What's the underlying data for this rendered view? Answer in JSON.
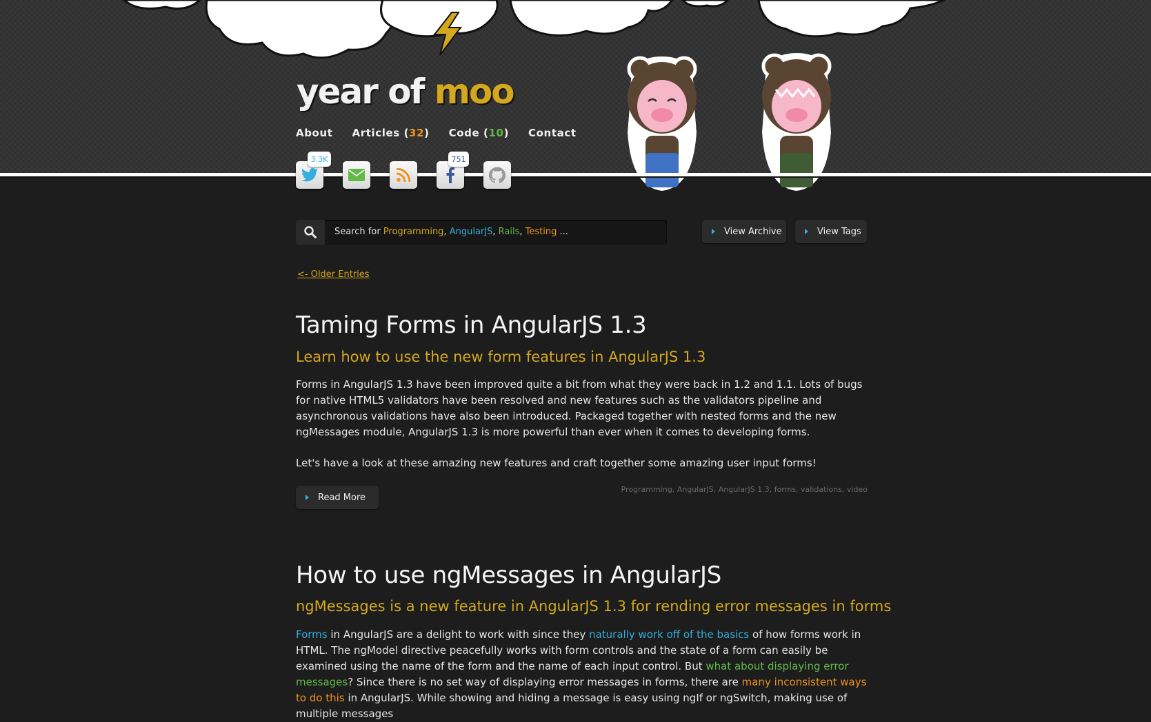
{
  "logo": {
    "part1": "year of",
    "part2": "moo"
  },
  "nav": {
    "about": "About",
    "articles_label": "Articles (",
    "articles_count": "32",
    "code_label": "Code (",
    "code_count": "10",
    "close_paren": ")",
    "contact": "Contact"
  },
  "social": {
    "twitter_count": "3.3K",
    "facebook_count": "751",
    "icons": [
      "twitter-icon",
      "email-icon",
      "rss-icon",
      "facebook-icon",
      "github-icon"
    ]
  },
  "search": {
    "prefix": "Search for ",
    "term1": "Programming",
    "term2": "AngularJS",
    "term3": "Rails",
    "term4": "Testing",
    "comma": ",",
    "ellipsis": " ..."
  },
  "buttons": {
    "view_archive": "View Archive",
    "view_tags": "View Tags",
    "read_more": "Read More"
  },
  "older_entries": "<- Older Entries",
  "posts": [
    {
      "title": "Taming Forms in AngularJS 1.3",
      "subtitle": "Learn how to use the new form features in AngularJS 1.3",
      "para1": "Forms in AngularJS 1.3 have been improved quite a bit from what they were back in 1.2 and 1.1. Lots of bugs for native HTML5 validators have been resolved and new features such as the validators pipeline and asynchronous validations have also been introduced. Packaged together with nested forms and the new ngMessages module, AngularJS 1.3 is more powerful than ever when it comes to developing forms.",
      "para2": "Let's have a look at these amazing new features and craft together some amazing user input forms!",
      "tags": "Programming, AngularJS, AngularJS 1.3, forms, validations, video"
    },
    {
      "title": "How to use ngMessages in AngularJS",
      "subtitle": "ngMessages is a new feature in AngularJS 1.3 for rending error messages in forms",
      "p_a": "Forms",
      "p_b": " in AngularJS are a delight to work with since they ",
      "p_c": "naturally work off of the basics",
      "p_d": " of how forms work in HTML. The ngModel directive peacefully works with form controls and the state of a form can easily be examined using the name of the form and the name of each input control. But ",
      "p_e": "what about displaying error messages",
      "p_f": "? Since there is no set way of displaying error messages in forms, there are ",
      "p_g": "many inconsistent ways to do this",
      "p_h": " in AngularJS. While showing and hiding a message is easy using ngIf or ngSwitch, making use of multiple messages"
    }
  ],
  "colors": {
    "accent_gold": "#d4a81e",
    "link_blue": "#33aedd",
    "link_green": "#62b946",
    "link_orange": "#f0921e"
  }
}
